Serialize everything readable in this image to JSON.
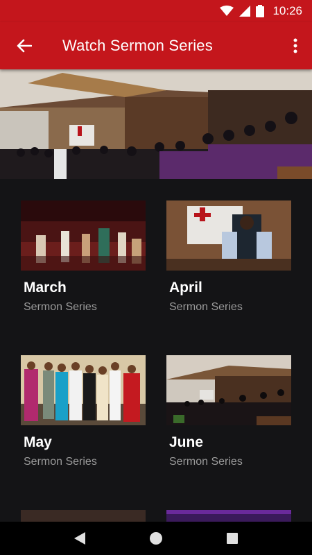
{
  "status_bar": {
    "time": "10:26"
  },
  "app_bar": {
    "title": "Watch Sermon Series",
    "back_icon": "arrow-back-icon",
    "menu_icon": "more-vert-icon"
  },
  "colors": {
    "brand_red": "#c4161c",
    "background": "#141416"
  },
  "series": [
    {
      "title": "March",
      "subtitle": "Sermon Series"
    },
    {
      "title": "April",
      "subtitle": "Sermon Series"
    },
    {
      "title": "May",
      "subtitle": "Sermon Series"
    },
    {
      "title": "June",
      "subtitle": "Sermon Series"
    }
  ],
  "nav": {
    "back": "nav-back-icon",
    "home": "nav-home-icon",
    "recents": "nav-recents-icon"
  }
}
